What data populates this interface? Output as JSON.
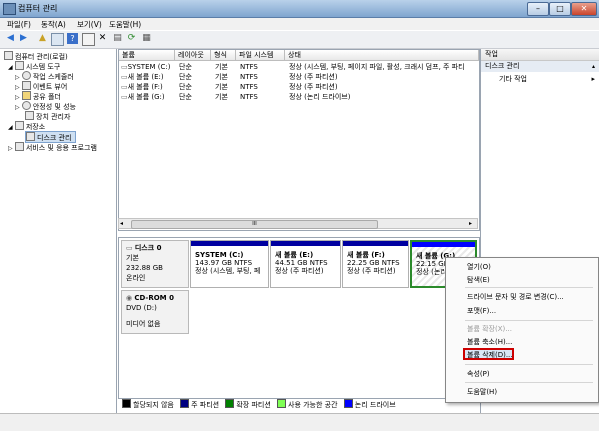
{
  "window": {
    "title": "컴퓨터 관리",
    "min": "–",
    "max": "□",
    "close": "✕"
  },
  "menu": [
    "파일(F)",
    "동작(A)",
    "보기(V)",
    "도움말(H)"
  ],
  "toolbar_icons": [
    "back-icon",
    "forward-icon",
    "up-icon",
    "show-hide-tree-icon",
    "help-icon",
    "properties-icon",
    "delete-icon",
    "export-icon",
    "refresh-icon",
    "view-icon"
  ],
  "tree": {
    "root": "컴퓨터 관리(로컬)",
    "system_tools": "시스템 도구",
    "task_scheduler": "작업 스케줄러",
    "event_viewer": "이벤트 뷰어",
    "shared_folders": "공유 폴더",
    "reliability": "안정성 및 성능",
    "device_manager": "장치 관리자",
    "storage": "저장소",
    "disk_management": "디스크 관리",
    "services": "서비스 및 응용 프로그램"
  },
  "volumes": {
    "headers": [
      "볼륨",
      "레이아웃",
      "형식",
      "파일 시스템",
      "상태"
    ],
    "rows": [
      [
        "SYSTEM (C:)",
        "단순",
        "기본",
        "NTFS",
        "정상 (시스템, 부팅, 페이지 파일, 활성, 크래시 덤프, 주 파티"
      ],
      [
        "새 볼륨 (E:)",
        "단순",
        "기본",
        "NTFS",
        "정상 (주 파티션)"
      ],
      [
        "새 볼륨 (F:)",
        "단순",
        "기본",
        "NTFS",
        "정상 (주 파티션)"
      ],
      [
        "새 볼륨 (G:)",
        "단순",
        "기본",
        "NTFS",
        "정상 (논리 드라이브)"
      ]
    ],
    "scroll_mark": "III"
  },
  "disk0": {
    "name": "디스크 0",
    "type": "기본",
    "size": "232.88 GB",
    "status": "온라인",
    "partitions": [
      {
        "name": "SYSTEM  (C:)",
        "size": "143.97 GB NTFS",
        "status": "정상 (시스템, 부팅, 페"
      },
      {
        "name": "새 볼륨  (E:)",
        "size": "44.51 GB NTFS",
        "status": "정상 (주 파티션)"
      },
      {
        "name": "새 볼륨  (F:)",
        "size": "22.25 GB NTFS",
        "status": "정상 (주 파티션)"
      },
      {
        "name": "새 볼륨  (G:)",
        "size": "22.15 GB",
        "status": "정상 (논리"
      }
    ]
  },
  "cdrom": {
    "name": "CD-ROM 0",
    "drive": "DVD (D:)",
    "media": "미디어 없음"
  },
  "legend": [
    "할당되지 않음",
    "주 파티션",
    "확장 파티션",
    "사용 가능한 공간",
    "논리 드라이브"
  ],
  "legend_colors": [
    "#000000",
    "#000080",
    "#008000",
    "#7fff55",
    "#0000ff"
  ],
  "actions": {
    "title": "작업",
    "section": "디스크 관리",
    "more": "기타 작업",
    "arrow": "▸"
  },
  "context_menu": [
    "열기(O)",
    "탐색(E)",
    "드라이브 문자 및 경로 변경(C)...",
    "포맷(F)...",
    "볼륨 확장(X)...",
    "볼륨 축소(H)...",
    "볼륨 삭제(D)...",
    "속성(P)",
    "도움말(H)"
  ]
}
